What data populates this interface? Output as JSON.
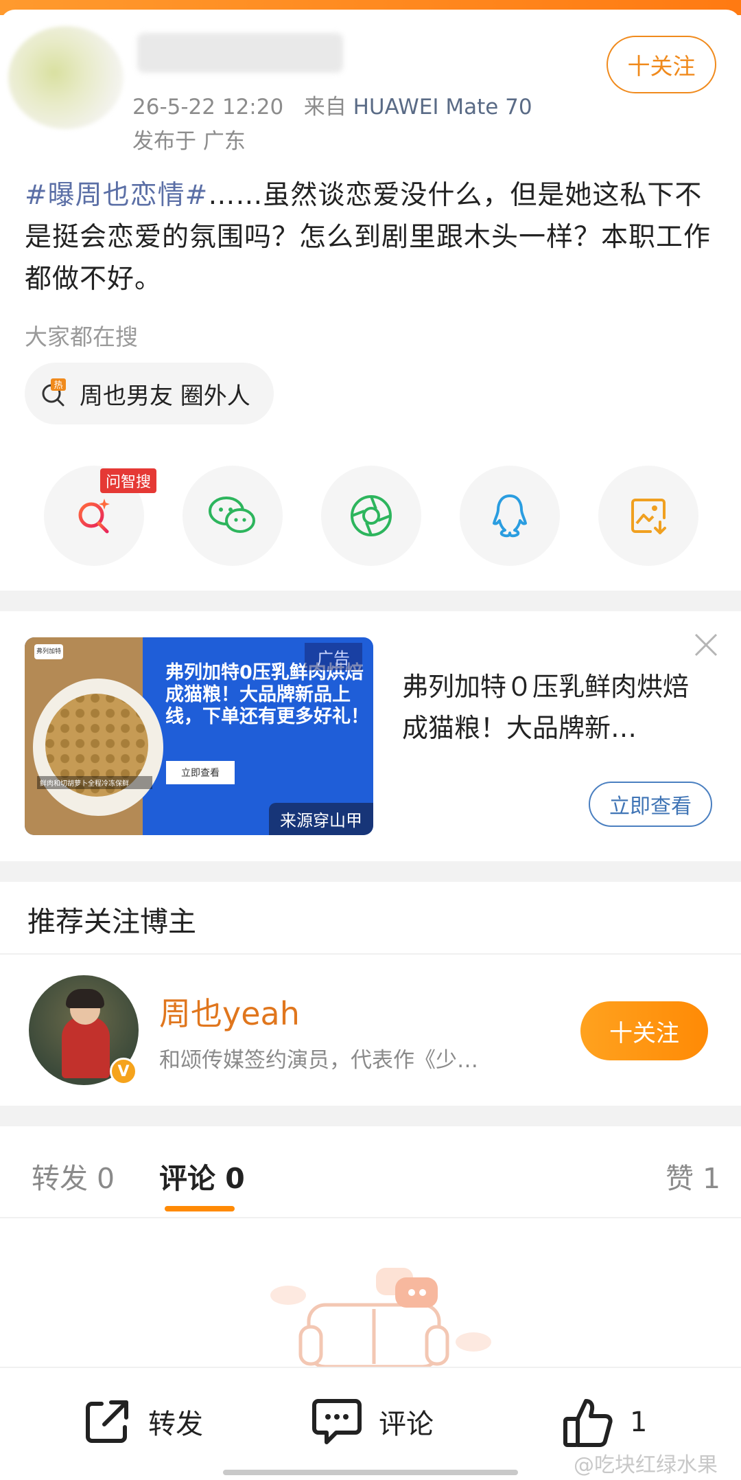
{
  "post": {
    "date": "26-5-22 12:20",
    "source_prefix": "来自",
    "device": "HUAWEI Mate 70",
    "location": "发布于 广东",
    "follow_label": "十关注",
    "hashtag": "#曝周也恋情#",
    "body": "……虽然谈恋爱没什么，但是她这私下不是挺会恋爱的氛围吗？怎么到剧里跟木头一样？本职工作都做不好。"
  },
  "search": {
    "hint": "大家都在搜",
    "hot_badge": "热",
    "hot_query": "周也男友 圈外人"
  },
  "share": {
    "zhi_badge": "问智搜",
    "items": [
      "ai-search-icon",
      "wechat-icon",
      "moments-icon",
      "qq-icon",
      "save-image-icon"
    ]
  },
  "ad": {
    "headline": "弗列加特0压乳鲜肉烘焙成猫粮！大品牌新品上线，下单还有更多好礼！",
    "image_button": "立即查看",
    "ad_tag": "广告",
    "source": "来源穿山甲",
    "logo_text": "弗列加特",
    "caption": "鲜肉和切胡萝卜全程冷冻保鲜",
    "title": "弗列加特０压乳鲜肉烘焙成猫粮！大品牌新…",
    "cta": "立即查看"
  },
  "recommend": {
    "section_title": "推荐关注博主",
    "name": "周也yeah",
    "desc": "和颂传媒签约演员，代表作《少…",
    "verified_badge": "V",
    "follow_label": "十关注"
  },
  "tabs": {
    "repost": "转发 0",
    "comment": "评论 0",
    "like": "赞 1"
  },
  "bottom": {
    "repost": "转发",
    "comment": "评论",
    "like_count": "1"
  },
  "watermark": "@吃块红绿水果",
  "colors": {
    "accent_orange": "#ff8a05",
    "link_blue": "#5b6fa6",
    "verified": "#f5a31c"
  }
}
